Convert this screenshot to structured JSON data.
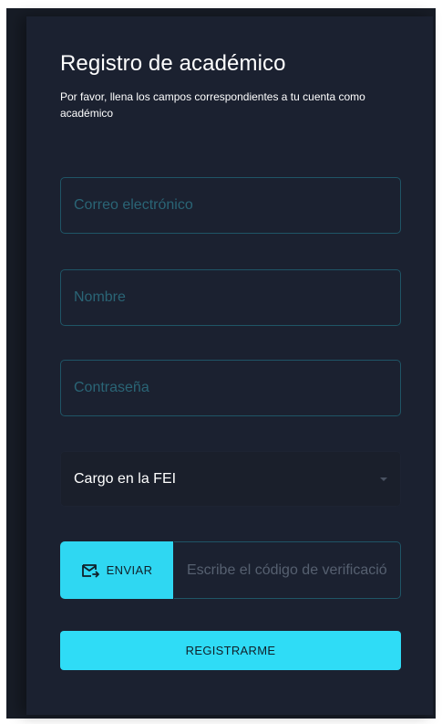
{
  "form": {
    "title": "Registro de académico",
    "subtitle": "Por favor, llena los campos correspondientes a tu cuenta como académico",
    "email": {
      "placeholder": "Correo electrónico",
      "value": ""
    },
    "name": {
      "placeholder": "Nombre",
      "value": ""
    },
    "password": {
      "placeholder": "Contraseña",
      "value": ""
    },
    "position_select": {
      "selected": "Cargo en la FEI",
      "icon": "caret-down-icon"
    },
    "send_button": {
      "label": "ENVIAR",
      "icon": "mail-send-icon"
    },
    "code": {
      "placeholder": "Escribe el código de verificación",
      "value": ""
    },
    "register_button": {
      "label": "REGISTRARME"
    }
  },
  "colors": {
    "background": "#171c26",
    "card": "#1b2130",
    "accent": "#2fdcf6",
    "field_border": "#1f5566",
    "placeholder": "#2a6576"
  }
}
